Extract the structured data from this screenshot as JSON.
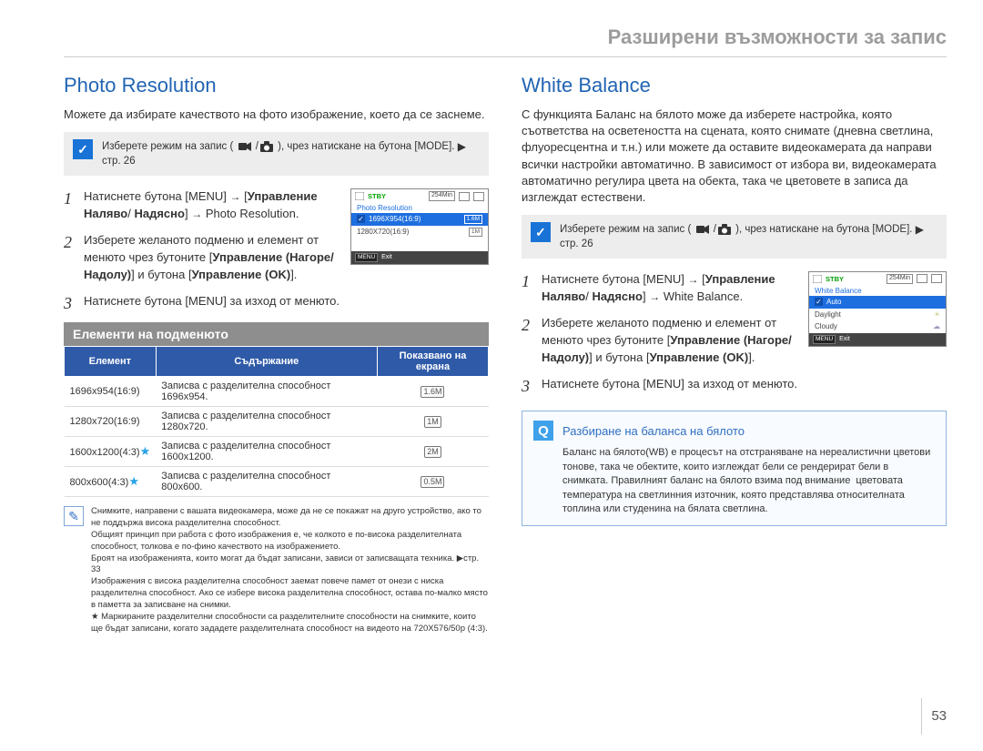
{
  "header": {
    "title": "Разширени възможности за запис"
  },
  "page_number": "53",
  "left": {
    "section_title": "Photo Resolution",
    "intro": "Можете да избирате качеството на фото изображение, което да се заснеме.",
    "note": {
      "prefix": "Изберете режим на запис (",
      "suffix": "), чрез натискане на бутона [MODE]. ",
      "arrow": "▶",
      "page_ref": "стр. 26"
    },
    "steps": {
      "s1_a": "Натиснете бутона [MENU]",
      "s1_b_bold1": "Управление Наляво",
      "s1_b_bold2": "Надясно",
      "s1_c": "Photo Resolution",
      "s2_a": "Изберете желаното подменю и елемент от менюто чрез бутоните [",
      "s2_b_bold": "Управление (Нагоре/ Надолу)",
      "s2_c": "] и бутона [",
      "s2_d_bold": "Управление (OK)",
      "s2_e": "].",
      "s3": "Натиснете бутона [MENU] за изход от менюто."
    },
    "screen": {
      "stby": "STBY",
      "timer": "254Min",
      "title": "Photo Resolution",
      "opt_selected": "1696X954(16:9)",
      "opt_other": "1280X720(16:9)",
      "selected_icon_text": "1.6M",
      "other_icon_text": "1M",
      "menu_key": "MENU",
      "exit": "Exit"
    },
    "sub_heading": "Елементи на подменюто",
    "table": {
      "th1": "Елемент",
      "th2": "Съдържание",
      "th3": "Показвано на екрана",
      "rows": [
        {
          "elem": "1696x954(16:9)",
          "star": false,
          "desc": "Записва с разделителна способност 1696x954.",
          "icon": "1.6M"
        },
        {
          "elem": "1280x720(16:9)",
          "star": false,
          "desc": "Записва с разделителна способност 1280x720.",
          "icon": "1M"
        },
        {
          "elem": "1600x1200(4:3)",
          "star": true,
          "desc": "Записва с разделителна способност 1600x1200.",
          "icon": "2M"
        },
        {
          "elem": "800x600(4:3)",
          "star": true,
          "desc": "Записва с разделителна способност 800x600.",
          "icon": "0.5M"
        }
      ]
    },
    "tiny_note": "Снимките, направени с вашата видеокамера, може да не се покажат на друго устройство, ако то не поддържа висока разделителна способност.\nОбщият принцип при работа с фото изображения е, че колкото е по-висока разделителната способност, толкова е по-фино качеството на изображението.\nБроят на изображенията, които могат да бъдат записани, зависи от записващата техника. ▶стр. 33\nИзображения с висока разделителна способност заемат повече памет от онези с ниска разделителна способност. Ако се избере висока разделителна способност, остава по-малко място в паметта за записване на снимки.\n★ Маркираните разделителни способности са разделителните способности на снимките, които ще бъдат записани, когато зададете разделителната способност на видеото на 720X576/50p (4:3)."
  },
  "right": {
    "section_title": "White Balance",
    "intro": "С функцията Баланс на бялото може да изберете настройка, която съответства на осветеността на сцената, която снимате (дневна светлина, флуоресцентна и т.н.) или можете да оставите видеокамерата да направи всички настройки автоматично. В зависимост от избора ви, видеокамерата автоматично регулира цвета на обекта, така че цветовете в записа да изглеждат естествени.",
    "note": {
      "prefix": "Изберете режим на запис (",
      "suffix": "), чрез натискане на бутона [MODE]. ",
      "arrow": "▶",
      "page_ref": "стр. 26"
    },
    "steps": {
      "s1_a": "Натиснете бутона [MENU]",
      "s1_b_bold1": "Управление Наляво",
      "s1_b_bold2": "Надясно",
      "s1_c": "White Balance.",
      "s2_a": "Изберете желаното подменю и елемент от менюто чрез бутоните [",
      "s2_b_bold": "Управление (Нагоре/ Надолу)",
      "s2_c": "] и бутона [",
      "s2_d_bold": "Управление (OK)",
      "s2_e": "].",
      "s3": "Натиснете бутона [MENU] за изход от менюто."
    },
    "screen": {
      "stby": "STBY",
      "timer": "254Min",
      "title": "White Balance",
      "opt_selected": "Auto",
      "opt_daylight": "Daylight",
      "opt_cloudy": "Cloudy",
      "menu_key": "MENU",
      "exit": "Exit"
    },
    "infobox": {
      "title": "Разбиране на баланса на бялото",
      "body": "Баланс на бялото(WB) е процесът на отстраняване на нереалистични цветови тонове, така че обектите, които изглеждат бели се рендерират бели в снимката. Правилният баланс на бялото взима под внимание  цветовата температура на светлинния източник, която представлява относителната топлина или студенина на бялата светлина."
    }
  }
}
